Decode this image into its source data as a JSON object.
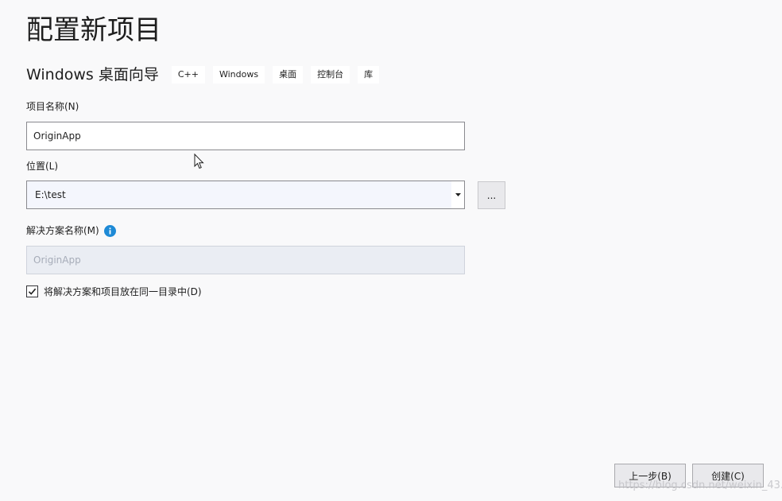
{
  "header": {
    "title": "配置新项目"
  },
  "template": {
    "name": "Windows 桌面向导",
    "tags": [
      "C++",
      "Windows",
      "桌面",
      "控制台",
      "库"
    ]
  },
  "project_name": {
    "label": "项目名称(N)",
    "value": "OriginApp"
  },
  "location": {
    "label": "位置(L)",
    "value": "E:\\test",
    "browse_label": "..."
  },
  "solution_name": {
    "label": "解决方案名称(M)",
    "value": "OriginApp",
    "info_icon": "info-icon"
  },
  "same_directory": {
    "label": "将解决方案和项目放在同一目录中(D)",
    "checked": true
  },
  "footer": {
    "back_label": "上一步(B)",
    "create_label": "创建(C)"
  },
  "watermark": {
    "text": "https://blog.csdn.net/weixin_43..."
  },
  "colors": {
    "background": "#f9f9fa",
    "info_blue": "#1e8ad6"
  }
}
